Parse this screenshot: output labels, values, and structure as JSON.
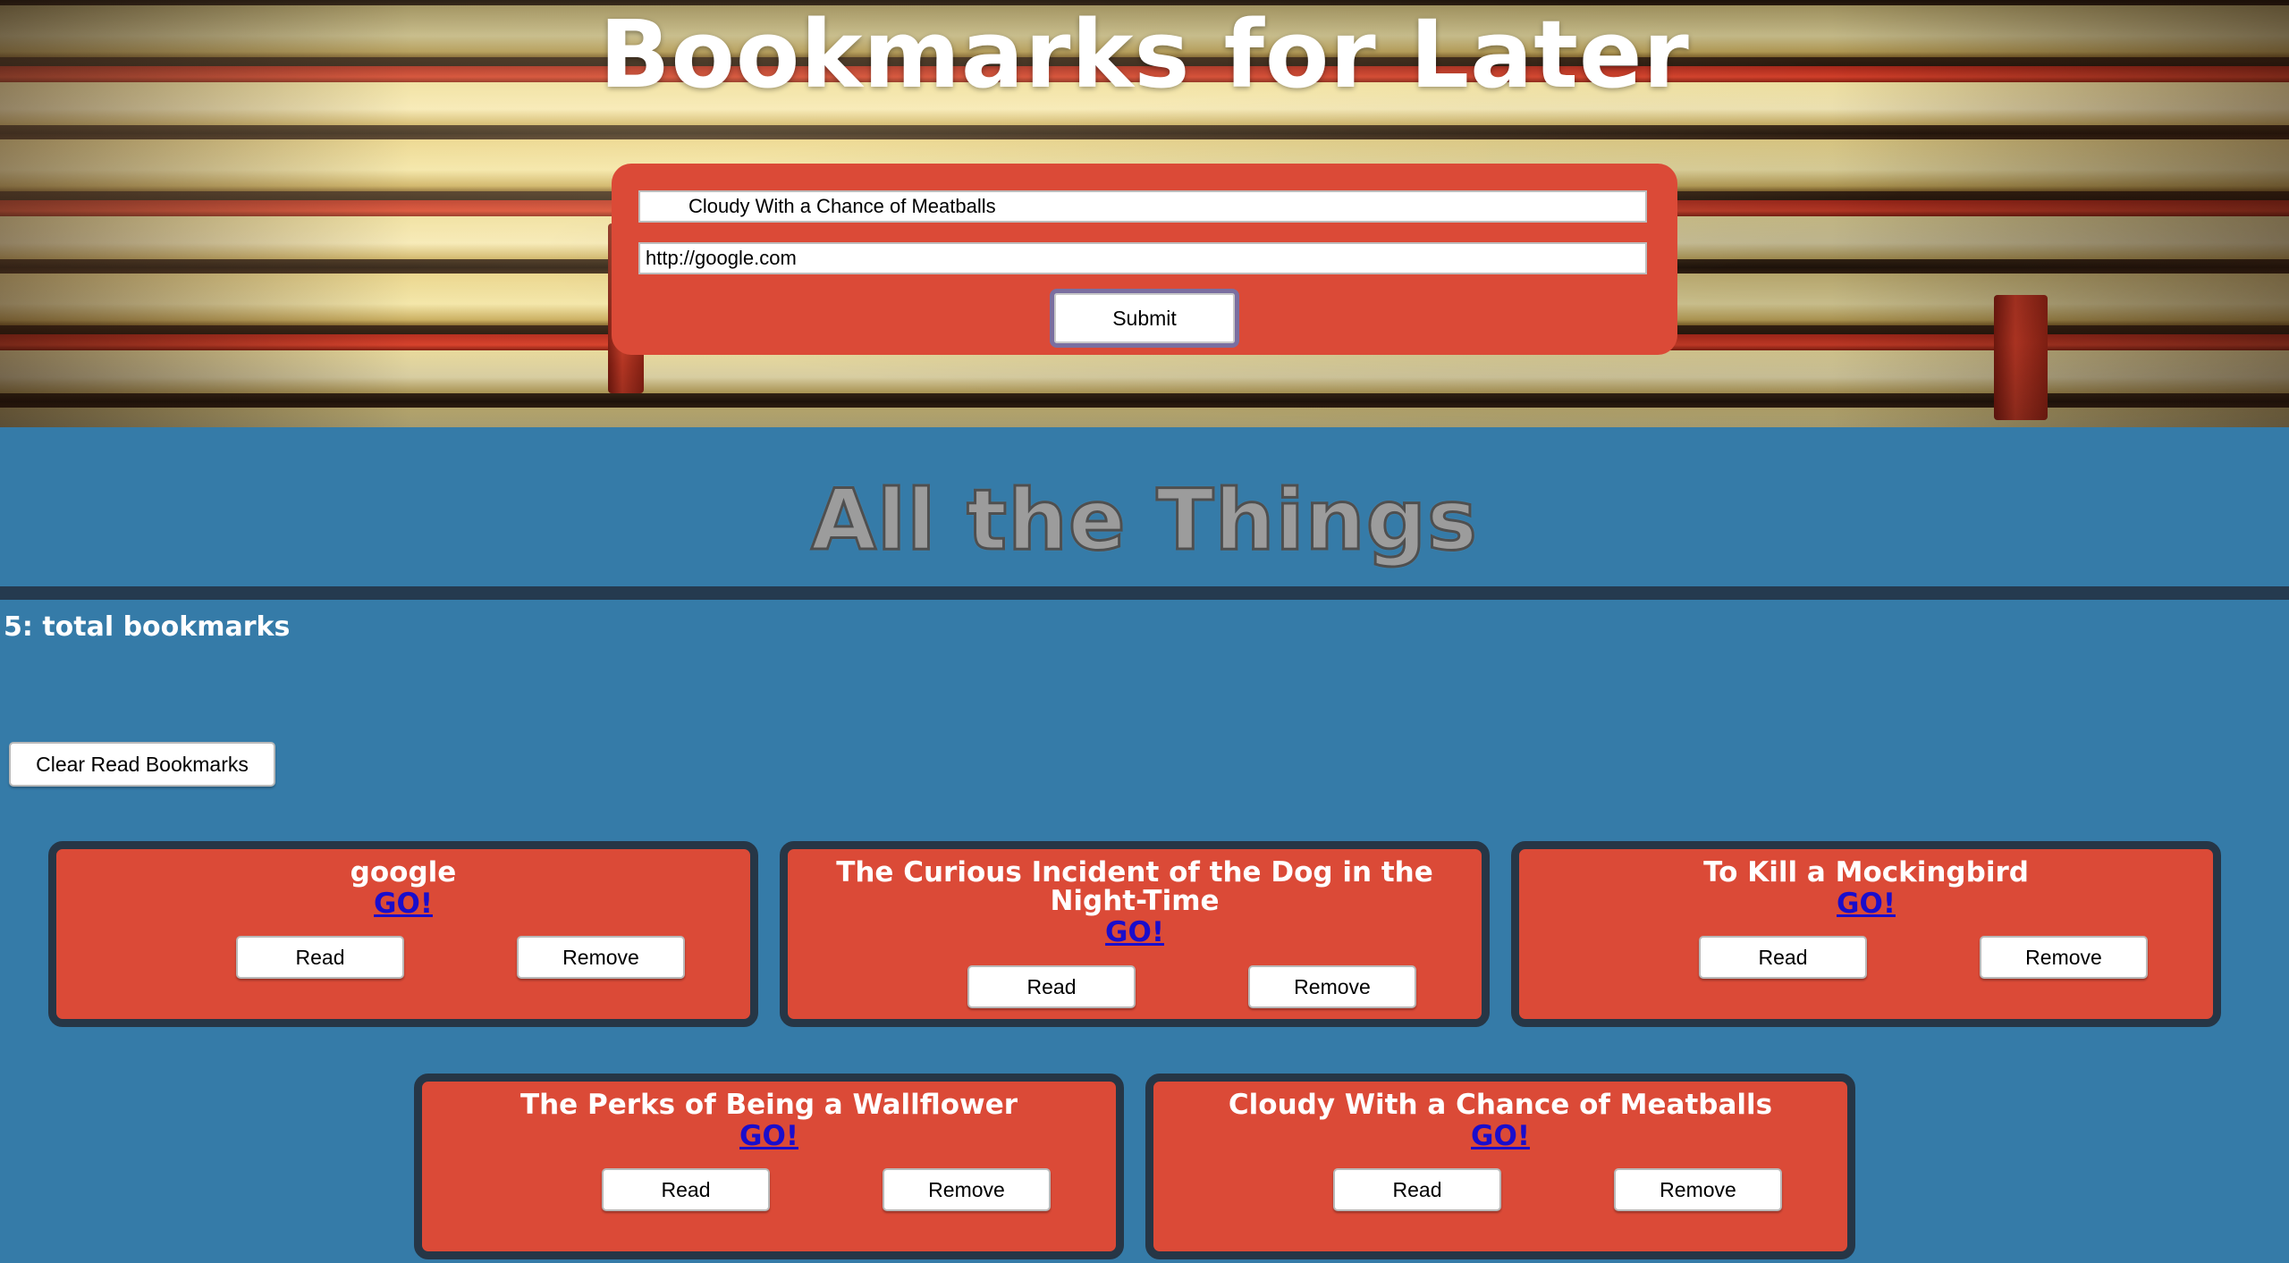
{
  "header": {
    "title": "Bookmarks for Later"
  },
  "form": {
    "title_value": "Cloudy With a Chance of Meatballs",
    "url_value": "http://google.com",
    "submit_label": "Submit"
  },
  "section": {
    "title": "All the Things",
    "count_text": "5: total bookmarks",
    "clear_label": "Clear Read Bookmarks"
  },
  "bookmarks": [
    {
      "title": "google",
      "link_label": "GO!",
      "read_label": "Read",
      "remove_label": "Remove"
    },
    {
      "title": "The Curious Incident of the Dog in the Night-Time",
      "link_label": "GO!",
      "read_label": "Read",
      "remove_label": "Remove"
    },
    {
      "title": "To Kill a Mockingbird",
      "link_label": "GO!",
      "read_label": "Read",
      "remove_label": "Remove"
    },
    {
      "title": "The Perks of Being a Wallflower",
      "link_label": "GO!",
      "read_label": "Read",
      "remove_label": "Remove"
    },
    {
      "title": "Cloudy With a Chance of Meatballs",
      "link_label": "GO!",
      "read_label": "Read",
      "remove_label": "Remove"
    }
  ],
  "colors": {
    "page_background": "#357ba8",
    "card_background": "#db4a37",
    "card_border": "#263646",
    "divider": "#253a4f",
    "link": "#1a0dcc"
  }
}
